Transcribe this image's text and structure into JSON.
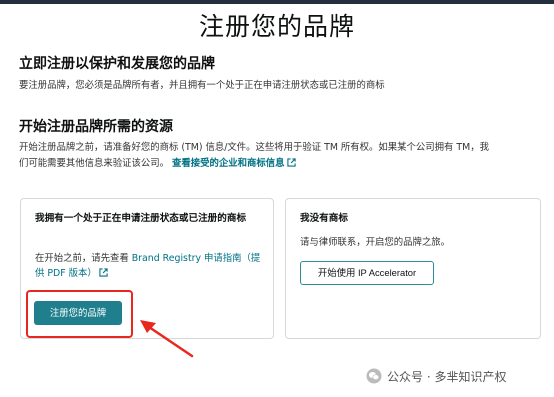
{
  "page": {
    "title": "注册您的品牌"
  },
  "intro": {
    "heading": "立即注册以保护和发展您的品牌",
    "text": "要注册品牌，您必须是品牌所有者，并且拥有一个处于正在申请注册状态或已注册的商标"
  },
  "resources": {
    "heading": "开始注册品牌所需的资源",
    "text_line1": "开始注册品牌之前，请准备好您的商标 (TM) 信息/文件。这些将用于验证 TM 所有权。如果某个公司拥有 TM，我",
    "text_line2": "们可能需要其他信息来验证该公司。",
    "link": "查看接受的企业和商标信息"
  },
  "card_left": {
    "title": "我拥有一个处于正在申请注册状态或已注册的商标",
    "text_prefix": "在开始之前，请先查看 ",
    "link": "Brand Registry 申请指南（提供 PDF 版本）",
    "button": "注册您的品牌"
  },
  "card_right": {
    "title": "我没有商标",
    "text": "请与律师联系，开启您的品牌之旅。",
    "button": "开始使用 IP Accelerator"
  },
  "watermark": {
    "text": "公众号 · 多芈知识产权"
  },
  "colors": {
    "link": "#007185",
    "primary_button": "#1f7f8c",
    "highlight": "#e8281e",
    "topbar": "#232f3e"
  }
}
